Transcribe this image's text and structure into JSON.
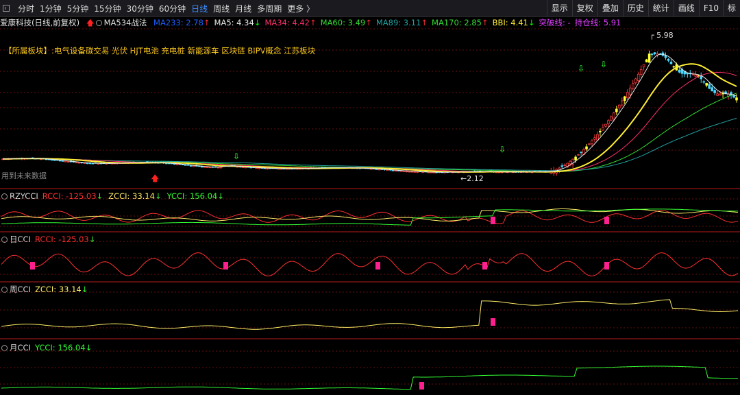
{
  "toolbar": {
    "periods": [
      "分时",
      "1分钟",
      "5分钟",
      "15分钟",
      "30分钟",
      "60分钟",
      "日线",
      "周线",
      "月线",
      "多周期",
      "更多 〉"
    ],
    "active_period": "日线",
    "right_buttons": [
      "显示",
      "复权",
      "叠加",
      "历史",
      "统计",
      "画线",
      "F10",
      "标"
    ]
  },
  "legend": {
    "stock_name": "爱康科技",
    "mode": "(日线,前复权)",
    "indicator": "MA534战法",
    "items": [
      {
        "text": "MA233: 2.78",
        "color": "#1f5fff",
        "arrow": "↑",
        "arrow_color": "#ff3030"
      },
      {
        "text": "MA5: 4.34",
        "color": "#e8e8e8",
        "arrow": "↓",
        "arrow_color": "#00ff00"
      },
      {
        "text": "MA34: 4.42",
        "color": "#ff2f6a",
        "arrow": "↑",
        "arrow_color": "#ff3030"
      },
      {
        "text": "MA60: 3.49",
        "color": "#33dd33",
        "arrow": "↑",
        "arrow_color": "#ff3030"
      },
      {
        "text": "MA89: 3.11",
        "color": "#24a0a0",
        "arrow": "↑",
        "arrow_color": "#ff3030"
      },
      {
        "text": "MA170: 2.85",
        "color": "#33dd33",
        "arrow": "↑",
        "arrow_color": "#ff3030"
      },
      {
        "text": "BBI: 4.41",
        "color": "#ffee33",
        "arrow": "↓",
        "arrow_color": "#00ff00"
      },
      {
        "text": "突破线: -",
        "color": "#e040ff",
        "arrow": "",
        "arrow_color": ""
      },
      {
        "text": "持仓线: 5.91",
        "color": "#e040ff",
        "arrow": "",
        "arrow_color": ""
      }
    ]
  },
  "sector": {
    "tag": "【所属板块】",
    "text": ":电气设备碳交易 光伏 HJT电池 充电桩 新能源车 区块链 BIPV概念 江苏板块"
  },
  "main_chart": {
    "high_label": "5.98",
    "low_label": "2.12",
    "future_label": "用到未来数据"
  },
  "panels": [
    {
      "name": "RZYCCI",
      "values": [
        {
          "text": "RCCI: -125.03",
          "color": "#ff3030",
          "arrow": "↓"
        },
        {
          "text": "ZCCI: 33.14",
          "color": "#ffee66",
          "arrow": "↓"
        },
        {
          "text": "YCCI: 156.04",
          "color": "#33ff33",
          "arrow": "↓"
        }
      ]
    },
    {
      "name": "日CCI",
      "values": [
        {
          "text": "RCCI: -125.03",
          "color": "#ff3030",
          "arrow": "↓"
        }
      ]
    },
    {
      "name": "周CCI",
      "values": [
        {
          "text": "ZCCI: 33.14",
          "color": "#ffee66",
          "arrow": "↓"
        }
      ]
    },
    {
      "name": "月CCI",
      "values": [
        {
          "text": "YCCI: 156.04",
          "color": "#33ff33",
          "arrow": "↓"
        }
      ]
    }
  ],
  "colors": {
    "up": "#ff3b3b",
    "down": "#48d8ff",
    "highlight": "#ffff33",
    "marker": "#ff1f8e",
    "grid": "#6a0f0f"
  }
}
